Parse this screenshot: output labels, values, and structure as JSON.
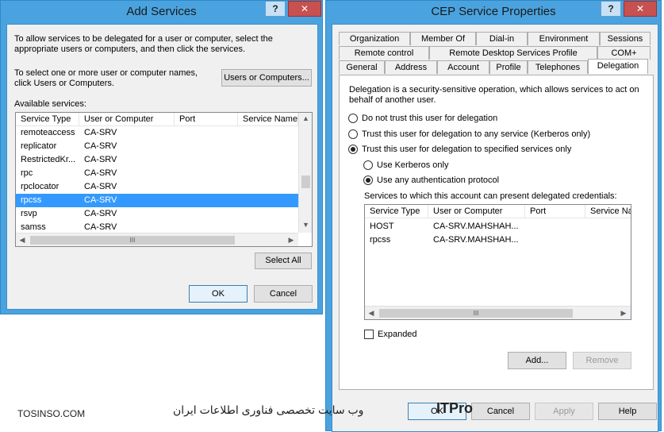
{
  "add_services": {
    "title": "Add Services",
    "help_icon": "question-mark-icon",
    "close_icon": "close-x-icon",
    "intro": "To allow services to be delegated for a user or computer, select the appropriate users or computers, and then click the services.",
    "select_hint": "To select one or more user or computer names, click Users or Computers.",
    "users_button": "Users or Computers...",
    "available_label": "Available services:",
    "columns": [
      "Service Type",
      "User or Computer",
      "Port",
      "Service Name"
    ],
    "rows": [
      [
        "remoteaccess",
        "CA-SRV"
      ],
      [
        "replicator",
        "CA-SRV"
      ],
      [
        "RestrictedKr...",
        "CA-SRV"
      ],
      [
        "rpc",
        "CA-SRV"
      ],
      [
        "rpclocator",
        "CA-SRV"
      ],
      [
        "rpcss",
        "CA-SRV"
      ],
      [
        "rsvp",
        "CA-SRV"
      ],
      [
        "samss",
        "CA-SRV"
      ]
    ],
    "selected_row": 5,
    "hscroll_glyph": "III",
    "select_all": "Select All",
    "ok": "OK",
    "cancel": "Cancel"
  },
  "cep": {
    "title": "CEP Service Properties",
    "tabs_row1": [
      "Organization",
      "Member Of",
      "Dial-in",
      "Environment",
      "Sessions"
    ],
    "tabs_row2": [
      "Remote control",
      "Remote Desktop Services Profile",
      "COM+"
    ],
    "tabs_row3": [
      "General",
      "Address",
      "Account",
      "Profile",
      "Telephones",
      "Delegation"
    ],
    "description": "Delegation is a security-sensitive operation, which allows services to act on behalf of another user.",
    "radio_no_trust": "Do not trust this user for delegation",
    "radio_any": "Trust this user for delegation to any service (Kerberos only)",
    "radio_specified": "Trust this user for delegation to specified services only",
    "radio_kerberos_only": "Use Kerberos only",
    "radio_any_protocol": "Use any authentication protocol",
    "services_label": "Services to which this account can present delegated credentials:",
    "columns": [
      "Service Type",
      "User or Computer",
      "Port",
      "Service Na"
    ],
    "rows": [
      [
        "HOST",
        "CA-SRV.MAHSHAH..."
      ],
      [
        "rpcss",
        "CA-SRV.MAHSHAH..."
      ]
    ],
    "hscroll_glyph": "III",
    "expanded": "Expanded",
    "add": "Add...",
    "remove": "Remove",
    "ok": "OK",
    "cancel": "Cancel",
    "apply": "Apply",
    "help": "Help"
  },
  "watermark": {
    "left": "TOSINSO.COM",
    "center": "وب سایت تخصصی فناوری اطلاعات ایران",
    "brand": "ITPro"
  }
}
